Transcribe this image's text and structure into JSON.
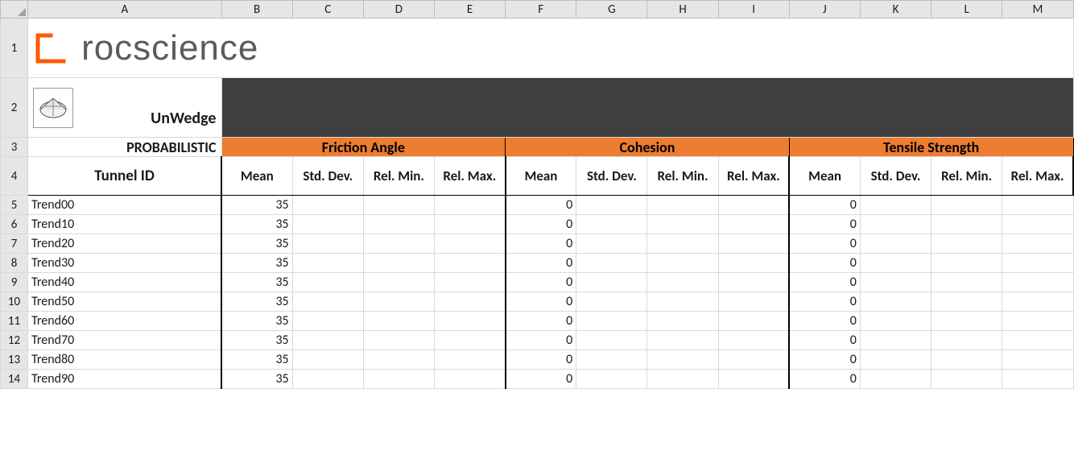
{
  "columns": [
    "A",
    "B",
    "C",
    "D",
    "E",
    "F",
    "G",
    "H",
    "I",
    "J",
    "K",
    "L",
    "M"
  ],
  "row_numbers": [
    1,
    2,
    3,
    4,
    5,
    6,
    7,
    8,
    9,
    10,
    11,
    12,
    13,
    14
  ],
  "brand": {
    "name": "rocscience"
  },
  "product": {
    "label": "UnWedge"
  },
  "row3": {
    "label": "PROBABILISTIC",
    "groups": [
      "Friction Angle",
      "Cohesion",
      "Tensile Strength"
    ]
  },
  "row4": {
    "id_label": "Tunnel ID",
    "sub_labels": [
      "Mean",
      "Std. Dev.",
      "Rel. Min.",
      "Rel. Max."
    ]
  },
  "data_rows": [
    {
      "id": "Trend00",
      "friction_mean": 35,
      "cohesion_mean": 0,
      "tensile_mean": 0
    },
    {
      "id": "Trend10",
      "friction_mean": 35,
      "cohesion_mean": 0,
      "tensile_mean": 0
    },
    {
      "id": "Trend20",
      "friction_mean": 35,
      "cohesion_mean": 0,
      "tensile_mean": 0
    },
    {
      "id": "Trend30",
      "friction_mean": 35,
      "cohesion_mean": 0,
      "tensile_mean": 0
    },
    {
      "id": "Trend40",
      "friction_mean": 35,
      "cohesion_mean": 0,
      "tensile_mean": 0
    },
    {
      "id": "Trend50",
      "friction_mean": 35,
      "cohesion_mean": 0,
      "tensile_mean": 0
    },
    {
      "id": "Trend60",
      "friction_mean": 35,
      "cohesion_mean": 0,
      "tensile_mean": 0
    },
    {
      "id": "Trend70",
      "friction_mean": 35,
      "cohesion_mean": 0,
      "tensile_mean": 0
    },
    {
      "id": "Trend80",
      "friction_mean": 35,
      "cohesion_mean": 0,
      "tensile_mean": 0
    },
    {
      "id": "Trend90",
      "friction_mean": 35,
      "cohesion_mean": 0,
      "tensile_mean": 0
    }
  ]
}
